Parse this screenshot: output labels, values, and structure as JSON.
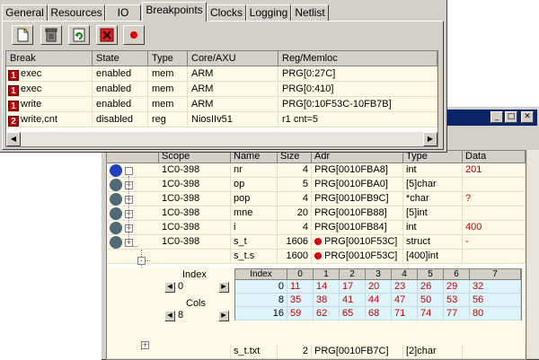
{
  "tabs": [
    {
      "label": "General"
    },
    {
      "label": "Resources"
    },
    {
      "label": "IO"
    },
    {
      "label": "Breakpoints"
    },
    {
      "label": "Clocks"
    },
    {
      "label": "Logging"
    },
    {
      "label": "Netlist"
    }
  ],
  "active_tab": "Breakpoints",
  "toolbar": [
    {
      "icon": "new-document-icon"
    },
    {
      "icon": "trash-icon"
    },
    {
      "icon": "refresh-icon"
    },
    {
      "icon": "delete-x-icon"
    },
    {
      "icon": "record-dot-icon"
    }
  ],
  "breakpoints": {
    "columns": [
      "Break",
      "State",
      "Type",
      "Core/AXU",
      "Reg/Memloc"
    ],
    "rows": [
      {
        "idx": "1",
        "break": "exec",
        "state": "enabled",
        "type": "mem",
        "core": "ARM",
        "loc": "PRG[0:27C]"
      },
      {
        "idx": "1",
        "break": "exec",
        "state": "enabled",
        "type": "mem",
        "core": "ARM",
        "loc": "PRG[0:410]"
      },
      {
        "idx": "1",
        "break": "write",
        "state": "enabled",
        "type": "mem",
        "core": "ARM",
        "loc": "PRG[0:10F53C-10FB7B]"
      },
      {
        "idx": "2",
        "break": "write,cnt",
        "state": "disabled",
        "type": "reg",
        "core": "NiosIIv51",
        "loc": "r1 cnt=5"
      }
    ]
  },
  "watch": {
    "columns": [
      "Scope",
      "Name",
      "Size",
      "Adr",
      "Type",
      "Data"
    ],
    "rows": [
      {
        "scope": "1C0-398",
        "name": "nr",
        "size": "4",
        "adr": "PRG[0010FBA8]",
        "type": "int",
        "data": "201"
      },
      {
        "scope": "1C0-398",
        "name": "op",
        "size": "5",
        "adr": "PRG[0010FBA0]",
        "type": "[5]char",
        "data": ""
      },
      {
        "scope": "1C0-398",
        "name": "pop",
        "size": "4",
        "adr": "PRG[0010FB9C]",
        "type": "*char",
        "data": "?"
      },
      {
        "scope": "1C0-398",
        "name": "mne",
        "size": "20",
        "adr": "PRG[0010FB88]",
        "type": "[5]int",
        "data": ""
      },
      {
        "scope": "1C0-398",
        "name": "i",
        "size": "4",
        "adr": "PRG[0010FB84]",
        "type": "int",
        "data": "400"
      },
      {
        "scope": "1C0-398",
        "name": "s_t",
        "size": "1606",
        "adr": "PRG[0010F53C]",
        "type": "struct",
        "data": "-"
      },
      {
        "scope": "",
        "name": "s_t.s",
        "size": "1600",
        "adr": "PRG[0010F53C]",
        "type": "[400]int",
        "data": ""
      }
    ],
    "last_row": {
      "scope": "",
      "name": "s_t.txt",
      "size": "2",
      "adr": "PRG[0010FB7C]",
      "type": "[2]char",
      "data": ""
    },
    "index_label": "Index",
    "index_value": "0",
    "cols_label": "Cols",
    "cols_value": "8",
    "grid": {
      "header": [
        "Index",
        "0",
        "1",
        "2",
        "3",
        "4",
        "5",
        "6",
        "7"
      ],
      "rows": [
        {
          "index": "0",
          "values": [
            "11",
            "14",
            "17",
            "20",
            "23",
            "26",
            "29",
            "32"
          ]
        },
        {
          "index": "8",
          "values": [
            "35",
            "38",
            "41",
            "44",
            "47",
            "50",
            "53",
            "56"
          ]
        },
        {
          "index": "16",
          "values": [
            "59",
            "62",
            "65",
            "68",
            "71",
            "74",
            "77",
            "80"
          ]
        }
      ]
    }
  },
  "colors": {
    "accent_red": "#cc0000",
    "row_bg": "#fffbe8",
    "title_blue": "#0a246a"
  }
}
